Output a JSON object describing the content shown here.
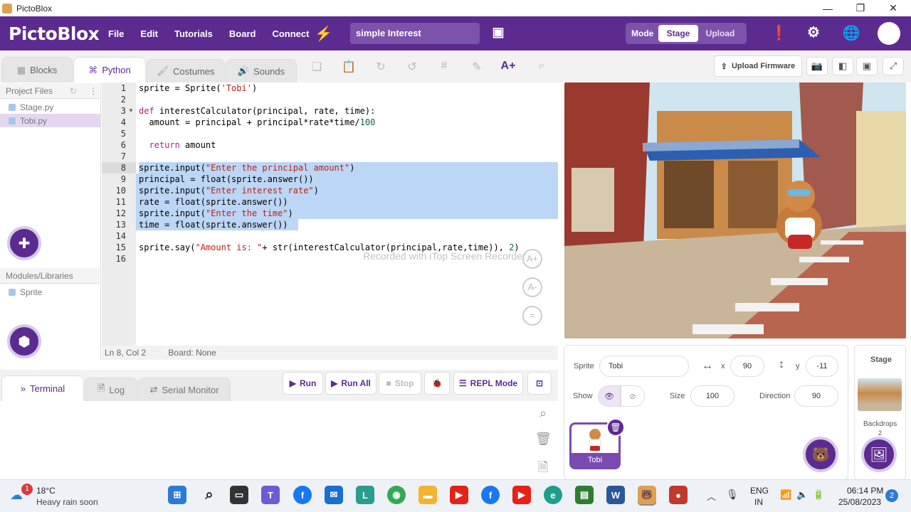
{
  "titlebar": {
    "title": "PictoBlox"
  },
  "menubar": {
    "brand": "PictoBlox",
    "items": [
      "File",
      "Edit",
      "Tutorials",
      "Board",
      "Connect"
    ],
    "project_name": "simple Interest",
    "mode_label": "Mode",
    "mode_stage": "Stage",
    "mode_upload": "Upload"
  },
  "tabs": {
    "blocks": "Blocks",
    "python": "Python",
    "costumes": "Costumes",
    "sounds": "Sounds"
  },
  "left": {
    "project_files": "Project Files",
    "files": [
      "Stage.py",
      "Tobi.py"
    ],
    "modules": "Modules/Libraries",
    "module_items": [
      "Sprite"
    ]
  },
  "editor": {
    "line_numbers": [
      "1",
      "2",
      "3",
      "4",
      "5",
      "6",
      "7",
      "8",
      "9",
      "10",
      "11",
      "12",
      "13",
      "14",
      "15",
      "16"
    ],
    "status_pos": "Ln 8, Col 2",
    "status_board": "Board: None",
    "watermark": "Recorded with iTop Screen Recorder"
  },
  "bottom": {
    "terminal": "Terminal",
    "log": "Log",
    "serial": "Serial Monitor",
    "run": "Run",
    "run_all": "Run All",
    "stop": "Stop",
    "repl": "REPL Mode"
  },
  "right": {
    "upload_firmware": "Upload Firmware"
  },
  "sprite": {
    "label": "Sprite",
    "name": "Tobi",
    "x_label": "x",
    "x": "90",
    "y_label": "y",
    "y": "-11",
    "show": "Show",
    "size_label": "Size",
    "size": "100",
    "direction_label": "Direction",
    "direction": "90",
    "card_name": "Tobi"
  },
  "stagepanel": {
    "title": "Stage",
    "backdrops": "Backdrops",
    "backdrop_count": "2"
  },
  "taskbar": {
    "temp": "18°C",
    "weather": "Heavy rain soon",
    "weather_badge": "1",
    "lang1": "ENG",
    "lang2": "IN",
    "time": "06:14 PM",
    "date": "25/08/2023",
    "notif": "2"
  },
  "colors": {
    "brand": "#5c2b8f",
    "selection": "#bcd6f5"
  }
}
